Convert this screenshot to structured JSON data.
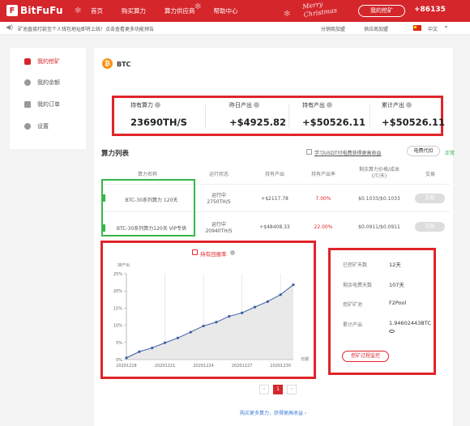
{
  "header": {
    "logo_mark": "F",
    "logo_text": "BitFuFu",
    "nav": [
      "首页",
      "购买算力",
      "算力供应商",
      "帮助中心"
    ],
    "promo_line1": "Merry",
    "promo_line2": "Christmas",
    "mine_button": "我的挖矿",
    "phone": "+86135"
  },
  "notice": {
    "text": "矿池直接打款至个人钱包地址即将上线！点击查看更多功能预告",
    "distributor": "分销商加盟",
    "supplier": "供应商加盟",
    "language": "中文"
  },
  "sidebar": {
    "items": [
      {
        "label": "我的挖矿",
        "icon": "mining-icon"
      },
      {
        "label": "我的余额",
        "icon": "balance-icon"
      },
      {
        "label": "我的订单",
        "icon": "order-icon"
      },
      {
        "label": "设置",
        "icon": "gear-icon"
      }
    ]
  },
  "coin": {
    "symbol_glyph": "₿",
    "name": "BTC",
    "color": "#f7931a"
  },
  "stats": [
    {
      "label": "持有算力",
      "value": "23690TH/S"
    },
    {
      "label": "昨日产出",
      "value": "+$4925.82"
    },
    {
      "label": "持有产出",
      "value": "+$50526.11"
    },
    {
      "label": "累计产出",
      "value": "+$50526.11"
    }
  ],
  "list": {
    "title": "算力列表",
    "usdt_link": "学习USDT付电费获得更高收益",
    "elec_button": "电费代扣",
    "status": "正常",
    "columns": [
      "算力名称",
      "运行状态",
      "持有产出",
      "持有产出率",
      "剩余算力价格/成本\n(/T/天)",
      "交易"
    ],
    "rows": [
      {
        "name": "BTC-30系列算力 120天",
        "status": "运行中",
        "power": "2750TH/S",
        "output": "+$2117.78",
        "rate": "7.00%",
        "price": "$0.1033/$0.1033",
        "trade": "交易"
      },
      {
        "name": "BTC-30系列算力120天 VIP专供",
        "status": "运行中",
        "power": "20940TH/S",
        "output": "+$48408.33",
        "rate": "22.00%",
        "price": "$0.0911/$0.0911",
        "trade": "交易"
      }
    ]
  },
  "chart": {
    "title": "持有回报率",
    "ylabel": "持产出",
    "xlabel": "日期"
  },
  "chart_data": {
    "type": "area",
    "x": [
      "20201218",
      "20201219",
      "20201220",
      "20201221",
      "20201222",
      "20201223",
      "20201224",
      "20201225",
      "20201226",
      "20201227",
      "20201228",
      "20201229",
      "20201230",
      "20201231"
    ],
    "xticks": [
      "20201218",
      "20201221",
      "20201224",
      "20201227",
      "20201230"
    ],
    "yticks": [
      "0%",
      "5%",
      "10%",
      "15%",
      "20%",
      "25%"
    ],
    "values": [
      0.5,
      2.3,
      3.4,
      4.9,
      6.3,
      8.0,
      9.8,
      10.9,
      12.6,
      13.6,
      15.3,
      16.9,
      18.9,
      21.8
    ],
    "ylim": [
      0,
      25
    ],
    "color": "#3b5ca8"
  },
  "info": {
    "items": [
      {
        "label": "已挖矿天数",
        "value": "12天"
      },
      {
        "label": "剩余电费天数",
        "value": "107天"
      },
      {
        "label": "挖矿矿池",
        "value": "F2Pool"
      },
      {
        "label": "累计产出",
        "value": "1.94602443BTC"
      }
    ],
    "monitor_button": "挖矿过程监控"
  },
  "pagination": {
    "prev": "‹",
    "current": "1",
    "next": "›"
  },
  "footer_link": "购买更多算力，获得更高收益 ›"
}
